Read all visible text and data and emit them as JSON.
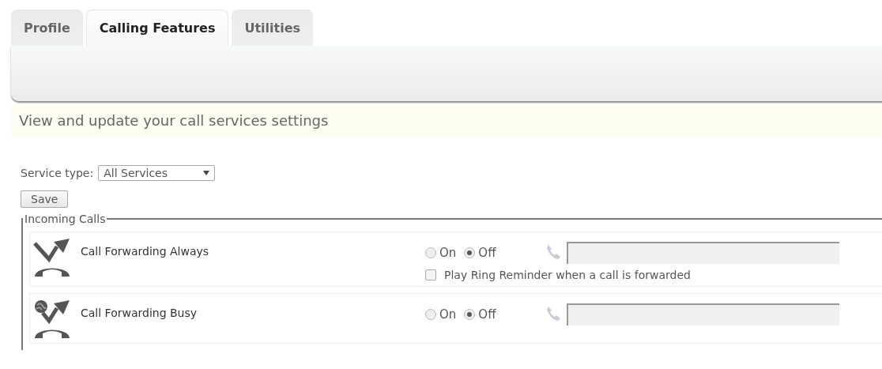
{
  "tabs": [
    {
      "label": "Profile",
      "selected": false
    },
    {
      "label": "Calling Features",
      "selected": true
    },
    {
      "label": "Utilities",
      "selected": false
    }
  ],
  "banner": "View and update your call services settings",
  "service_type": {
    "label": "Service type:",
    "value": "All Services"
  },
  "save_button": "Save",
  "group": {
    "legend": "Incoming Calls",
    "features": [
      {
        "kind": "always",
        "name": "Call Forwarding Always",
        "options": [
          {
            "label": "On",
            "selected": false
          },
          {
            "label": "Off",
            "selected": true
          }
        ],
        "reminder": {
          "label": "Play Ring Reminder when a call is forwarded",
          "checked": false
        }
      },
      {
        "kind": "busy",
        "name": "Call Forwarding Busy",
        "options": [
          {
            "label": "On",
            "selected": false
          },
          {
            "label": "Off",
            "selected": true
          }
        ]
      }
    ]
  }
}
